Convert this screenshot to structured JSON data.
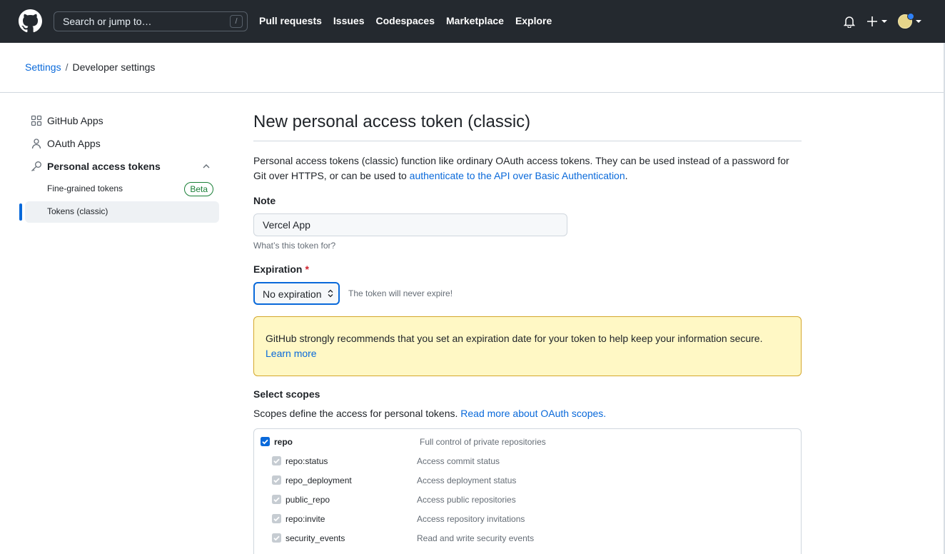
{
  "header": {
    "search_placeholder": "Search or jump to…",
    "search_key": "/",
    "nav": [
      "Pull requests",
      "Issues",
      "Codespaces",
      "Marketplace",
      "Explore"
    ]
  },
  "breadcrumb": {
    "root": "Settings",
    "separator": "/",
    "current": "Developer settings"
  },
  "sidebar": {
    "items": [
      {
        "label": "GitHub Apps",
        "icon": "apps-grid-icon"
      },
      {
        "label": "OAuth Apps",
        "icon": "person-icon"
      },
      {
        "label": "Personal access tokens",
        "icon": "key-icon"
      }
    ],
    "sub_items": [
      {
        "label": "Fine-grained tokens",
        "badge": "Beta"
      },
      {
        "label": "Tokens (classic)"
      }
    ]
  },
  "main": {
    "title": "New personal access token (classic)",
    "description": "Personal access tokens (classic) function like ordinary OAuth access tokens. They can be used instead of a password for Git over HTTPS, or can be used to ",
    "description_link": "authenticate to the API over Basic Authentication",
    "description_end": ".",
    "note_label": "Note",
    "note_value": "Vercel App",
    "note_hint": "What’s this token for?",
    "expiration_label": "Expiration",
    "required_mark": "*",
    "expiration_value": "No expiration",
    "expiration_hint": "The token will never expire!",
    "warning_text": "GitHub strongly recommends that you set an expiration date for your token to help keep your information secure.",
    "warning_link": "Learn more",
    "scopes_label": "Select scopes",
    "scopes_desc": "Scopes define the access for personal tokens. ",
    "scopes_link": "Read more about OAuth scopes.",
    "scopes": [
      {
        "name": "repo",
        "desc": "Full control of private repositories",
        "checked": true,
        "parent": true
      },
      {
        "name": "repo:status",
        "desc": "Access commit status",
        "checked": true,
        "parent": false
      },
      {
        "name": "repo_deployment",
        "desc": "Access deployment status",
        "checked": true,
        "parent": false
      },
      {
        "name": "public_repo",
        "desc": "Access public repositories",
        "checked": true,
        "parent": false
      },
      {
        "name": "repo:invite",
        "desc": "Access repository invitations",
        "checked": true,
        "parent": false
      },
      {
        "name": "security_events",
        "desc": "Read and write security events",
        "checked": true,
        "parent": false
      }
    ]
  },
  "colors": {
    "header_bg": "#24292f",
    "link": "#0969da",
    "warning_bg": "#fff8c5",
    "beta": "#1a7f37"
  }
}
